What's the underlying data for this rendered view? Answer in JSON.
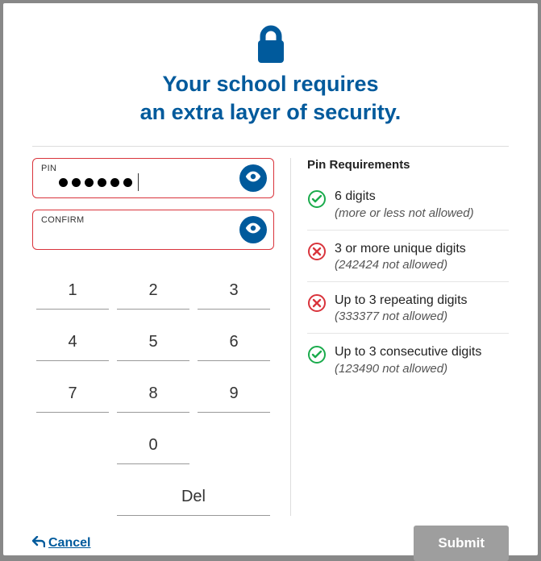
{
  "title_line1": "Your school requires",
  "title_line2": "an extra layer of security.",
  "pin": {
    "label": "PIN",
    "value_length": 6
  },
  "confirm": {
    "label": "CONFIRM",
    "value_length": 0
  },
  "keypad": {
    "k1": "1",
    "k2": "2",
    "k3": "3",
    "k4": "4",
    "k5": "5",
    "k6": "6",
    "k7": "7",
    "k8": "8",
    "k9": "9",
    "k0": "0",
    "del": "Del"
  },
  "requirements": {
    "title": "Pin Requirements",
    "items": [
      {
        "status": "ok",
        "text": "6 digits",
        "hint": "(more or less not allowed)"
      },
      {
        "status": "fail",
        "text": "3 or more unique digits",
        "hint": "(242424 not allowed)"
      },
      {
        "status": "fail",
        "text": "Up to 3 repeating digits",
        "hint": "(333377 not allowed)"
      },
      {
        "status": "ok",
        "text": "Up to 3 consecutive digits",
        "hint": "(123490 not allowed)"
      }
    ]
  },
  "footer": {
    "cancel": "Cancel",
    "submit": "Submit"
  },
  "colors": {
    "brand": "#005a9c",
    "ok": "#1aab4c",
    "fail": "#d9343c"
  }
}
